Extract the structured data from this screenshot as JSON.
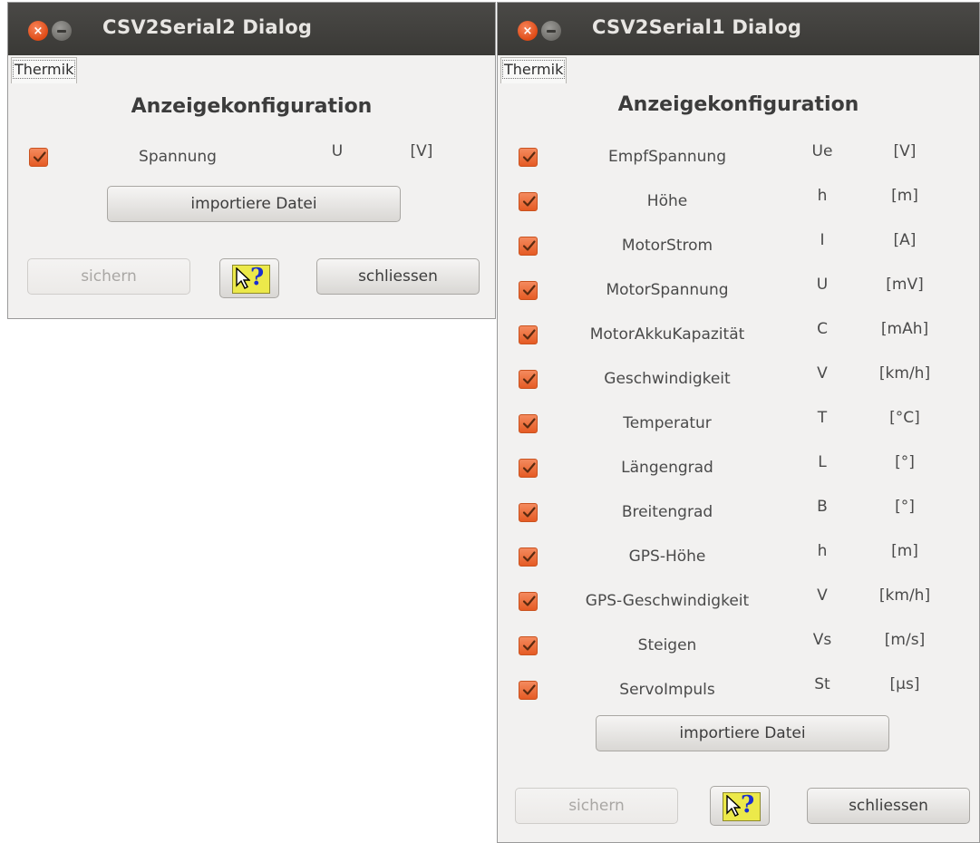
{
  "win2": {
    "title": "CSV2Serial2 Dialog",
    "tab": "Thermik",
    "heading": "Anzeigekonfiguration",
    "rows": [
      {
        "name": "Spannung",
        "symbol": "U",
        "unit": "[V]",
        "checked": true
      }
    ],
    "import_label": "importiere Datei",
    "save_label": "sichern",
    "close_label": "schliessen"
  },
  "win1": {
    "title": "CSV2Serial1 Dialog",
    "tab": "Thermik",
    "heading": "Anzeigekonfiguration",
    "rows": [
      {
        "name": "EmpfSpannung",
        "symbol": "Ue",
        "unit": "[V]",
        "checked": true
      },
      {
        "name": "Höhe",
        "symbol": "h",
        "unit": "[m]",
        "checked": true
      },
      {
        "name": "MotorStrom",
        "symbol": "I",
        "unit": "[A]",
        "checked": true
      },
      {
        "name": "MotorSpannung",
        "symbol": "U",
        "unit": "[mV]",
        "checked": true
      },
      {
        "name": "MotorAkkuKapazität",
        "symbol": "C",
        "unit": "[mAh]",
        "checked": true
      },
      {
        "name": "Geschwindigkeit",
        "symbol": "V",
        "unit": "[km/h]",
        "checked": true
      },
      {
        "name": "Temperatur",
        "symbol": "T",
        "unit": "[°C]",
        "checked": true
      },
      {
        "name": "Längengrad",
        "symbol": "L",
        "unit": "[°]",
        "checked": true
      },
      {
        "name": "Breitengrad",
        "symbol": "B",
        "unit": "[°]",
        "checked": true
      },
      {
        "name": "GPS-Höhe",
        "symbol": "h",
        "unit": "[m]",
        "checked": true
      },
      {
        "name": "GPS-Geschwindigkeit",
        "symbol": "V",
        "unit": "[km/h]",
        "checked": true
      },
      {
        "name": "Steigen",
        "symbol": "Vs",
        "unit": "[m/s]",
        "checked": true
      },
      {
        "name": "ServoImpuls",
        "symbol": "St",
        "unit": "[µs]",
        "checked": true
      }
    ],
    "import_label": "importiere Datei",
    "save_label": "sichern",
    "close_label": "schliessen"
  },
  "colors": {
    "checkbox": "#e55b24",
    "titlebar": "#3c3b37",
    "close": "#df4b16"
  },
  "icons": {
    "close": "close-icon",
    "minimize": "minimize-icon",
    "help": "help-cursor-icon",
    "check": "checkmark-icon"
  }
}
